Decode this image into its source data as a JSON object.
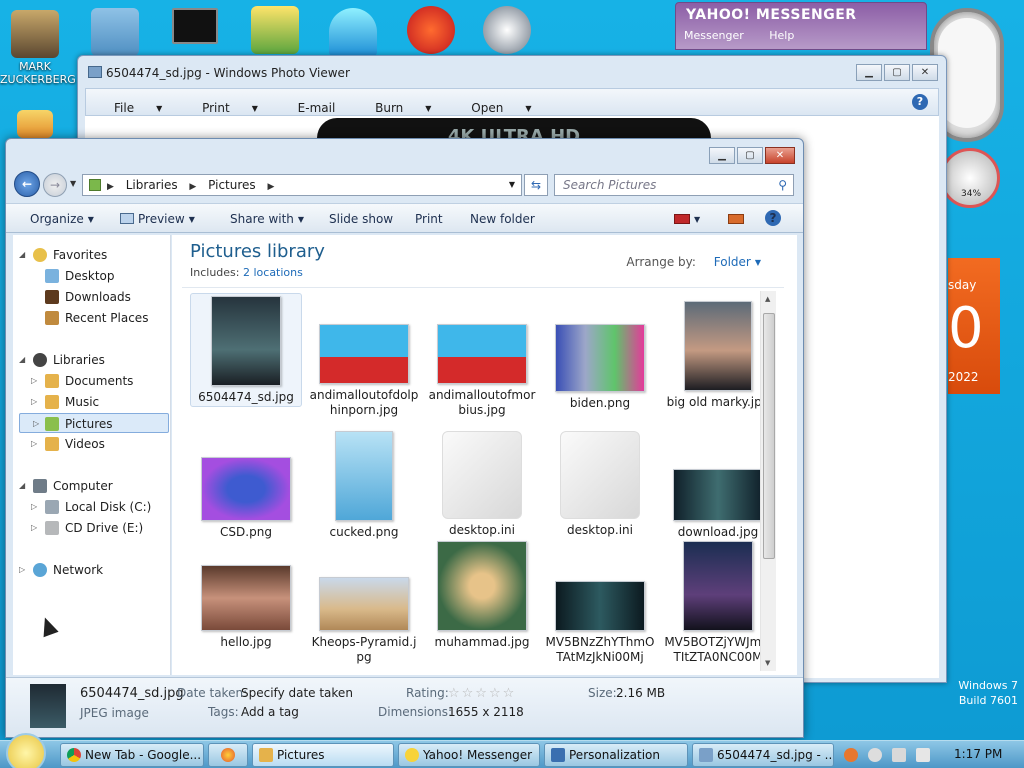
{
  "desktop": {
    "icons": [
      {
        "label": "MARK ZUCKERBERG"
      }
    ],
    "watermark": {
      "line1": "Windows 7",
      "line2": "Build 7601"
    }
  },
  "yahoo": {
    "title": "YAHOO! MESSENGER",
    "menu": [
      "Messenger",
      "Help"
    ]
  },
  "gadgets": {
    "meter_pct": "34%",
    "calendar_day": "sday",
    "calendar_date": "0",
    "calendar_year": "2022"
  },
  "photo_viewer": {
    "title": "6504474_sd.jpg - Windows Photo Viewer",
    "menu": [
      "File",
      "Print",
      "E-mail",
      "Burn",
      "Open"
    ],
    "image_banner": "4K ULTRA HD"
  },
  "explorer": {
    "breadcrumb": [
      "Libraries",
      "Pictures"
    ],
    "search_placeholder": "Search Pictures",
    "toolbar": {
      "organize": "Organize",
      "preview": "Preview",
      "share": "Share with",
      "slideshow": "Slide show",
      "print": "Print",
      "newfolder": "New folder"
    },
    "nav": {
      "favorites": "Favorites",
      "desktop": "Desktop",
      "downloads": "Downloads",
      "recent": "Recent Places",
      "libraries": "Libraries",
      "documents": "Documents",
      "music": "Music",
      "pictures": "Pictures",
      "videos": "Videos",
      "computer": "Computer",
      "localdisk": "Local Disk (C:)",
      "cddrive": "CD Drive (E:)",
      "network": "Network"
    },
    "library": {
      "title": "Pictures library",
      "includes_label": "Includes:",
      "includes_link": "2 locations",
      "arrange_label": "Arrange by:",
      "arrange_value": "Folder"
    },
    "files": [
      {
        "name": "6504474_sd.jpg"
      },
      {
        "name": "andimalloutofdolphinporn.jpg"
      },
      {
        "name": "andimalloutofmorbius.jpg"
      },
      {
        "name": "biden.png"
      },
      {
        "name": "big old marky.jpg"
      },
      {
        "name": "CSD.png"
      },
      {
        "name": "cucked.png"
      },
      {
        "name": "desktop.ini"
      },
      {
        "name": "desktop.ini"
      },
      {
        "name": "download.jpg"
      },
      {
        "name": "hello.jpg"
      },
      {
        "name": "Kheops-Pyramid.jpg"
      },
      {
        "name": "muhammad.jpg"
      },
      {
        "name": "MV5BNzZhYThmOTAtMzJkNi00Mj"
      },
      {
        "name": "MV5BOTZjYWJmMTItZTA0NC00M"
      }
    ],
    "details": {
      "filename": "6504474_sd.jpg",
      "filetype": "JPEG image",
      "date_key": "Date taken:",
      "date_val": "Specify date taken",
      "tags_key": "Tags:",
      "tags_val": "Add a tag",
      "rating_key": "Rating:",
      "dims_key": "Dimensions:",
      "dims_val": "1655 x 2118",
      "size_key": "Size:",
      "size_val": "2.16 MB"
    }
  },
  "taskbar": {
    "buttons": [
      {
        "label": "New Tab - Google..."
      },
      {
        "label": "Pictures"
      },
      {
        "label": "Yahoo! Messenger"
      },
      {
        "label": "Personalization"
      },
      {
        "label": "6504474_sd.jpg - ..."
      }
    ],
    "time": "1:17 PM"
  }
}
